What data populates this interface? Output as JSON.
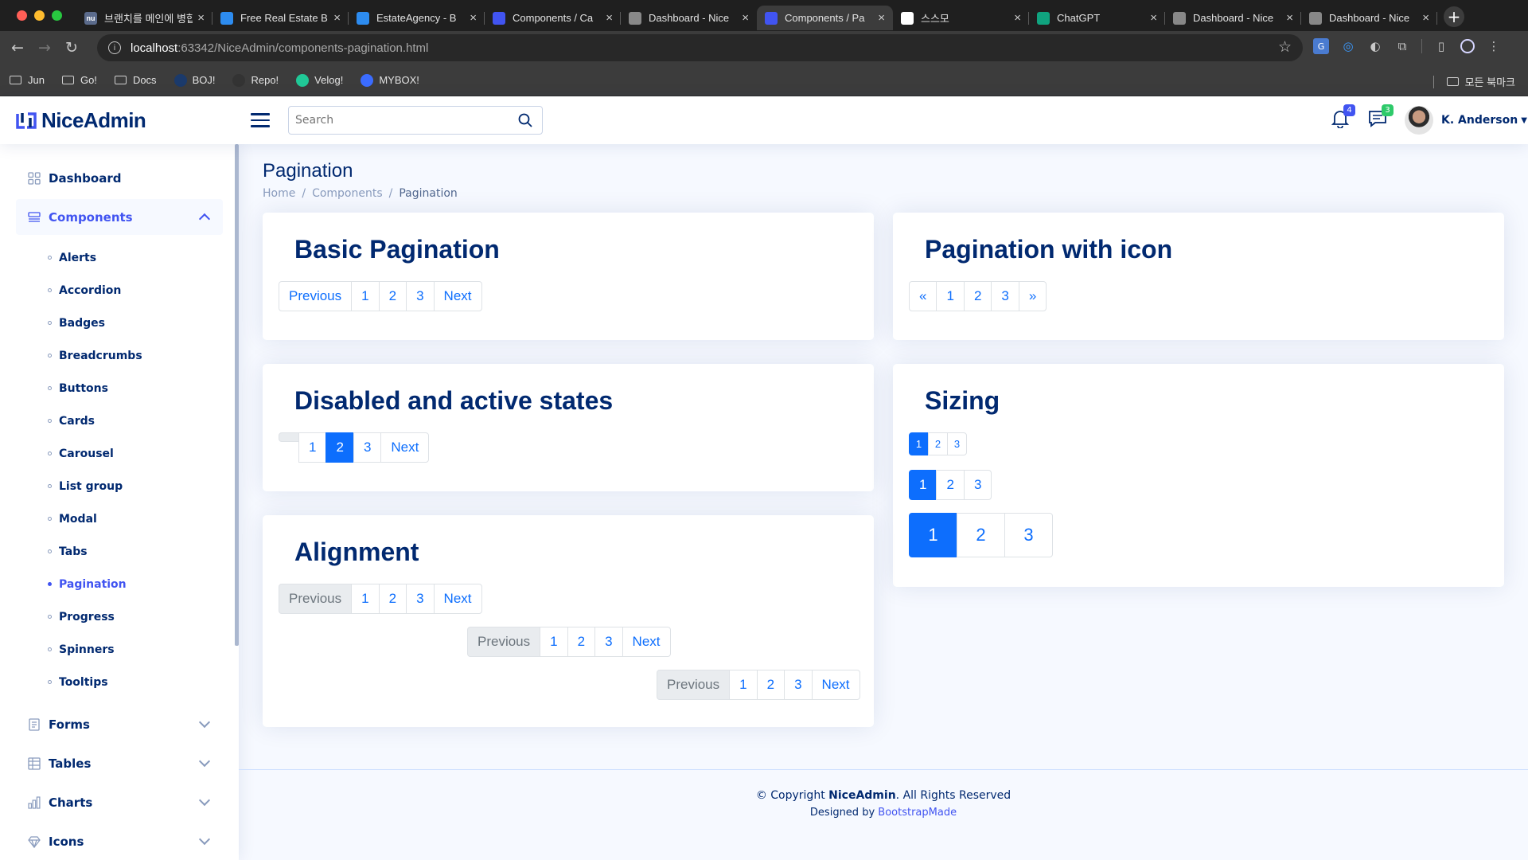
{
  "browser": {
    "tabs": [
      {
        "title": "브랜치를 메인에 병합",
        "fav": "nu",
        "color": "#5b6b8c"
      },
      {
        "title": "Free Real Estate B",
        "fav": "",
        "color": "#2d8cf0"
      },
      {
        "title": "EstateAgency - B",
        "fav": "",
        "color": "#2d8cf0"
      },
      {
        "title": "Components / Ca",
        "fav": "",
        "color": "#4154f1"
      },
      {
        "title": "Dashboard - Nice",
        "fav": "",
        "color": "#888888"
      },
      {
        "title": "Components / Pa",
        "fav": "",
        "color": "#4154f1"
      },
      {
        "title": "스스모",
        "fav": "",
        "color": "#ffffff"
      },
      {
        "title": "ChatGPT",
        "fav": "",
        "color": "#10a37f"
      },
      {
        "title": "Dashboard - Nice",
        "fav": "",
        "color": "#888888"
      },
      {
        "title": "Dashboard - Nice",
        "fav": "",
        "color": "#888888"
      }
    ],
    "url_host": "localhost",
    "url_path": ":63342/NiceAdmin/components-pagination.html",
    "bookmarks": [
      {
        "label": "Jun",
        "type": "folder"
      },
      {
        "label": "Go!",
        "type": "folder"
      },
      {
        "label": "Docs",
        "type": "folder"
      },
      {
        "label": "BOJ!",
        "type": "site"
      },
      {
        "label": "Repo!",
        "type": "site"
      },
      {
        "label": "Velog!",
        "type": "site"
      },
      {
        "label": "MYBOX!",
        "type": "site"
      }
    ],
    "all_bookmarks": "모든 북마크"
  },
  "header": {
    "logo_text": "NiceAdmin",
    "search_placeholder": "Search",
    "notifications_count": "4",
    "messages_count": "3",
    "user_name": "K. Anderson"
  },
  "sidebar": {
    "dashboard": "Dashboard",
    "components": "Components",
    "sub_items": [
      "Alerts",
      "Accordion",
      "Badges",
      "Breadcrumbs",
      "Buttons",
      "Cards",
      "Carousel",
      "List group",
      "Modal",
      "Tabs",
      "Pagination",
      "Progress",
      "Spinners",
      "Tooltips"
    ],
    "active_item": "Pagination",
    "forms": "Forms",
    "tables": "Tables",
    "charts": "Charts",
    "icons": "Icons"
  },
  "page": {
    "title": "Pagination",
    "breadcrumb": [
      "Home",
      "Components",
      "Pagination"
    ]
  },
  "cards": {
    "basic": {
      "title": "Basic Pagination",
      "items": [
        "Previous",
        "1",
        "2",
        "3",
        "Next"
      ]
    },
    "icon": {
      "title": "Pagination with icon",
      "items": [
        "«",
        "1",
        "2",
        "3",
        "»"
      ]
    },
    "states": {
      "title": "Disabled and active states",
      "items": [
        "1",
        "2",
        "3",
        "Next"
      ],
      "active": "2"
    },
    "sizing": {
      "title": "Sizing",
      "items": [
        "1",
        "2",
        "3"
      ],
      "active": "1"
    },
    "alignment": {
      "title": "Alignment",
      "items": [
        "Previous",
        "1",
        "2",
        "3",
        "Next"
      ],
      "disabled": "Previous"
    }
  },
  "footer": {
    "copyright_prefix": "© Copyright ",
    "brand": "NiceAdmin",
    "copyright_suffix": ". All Rights Reserved",
    "designed_by": "Designed by ",
    "designer": "BootstrapMade"
  }
}
